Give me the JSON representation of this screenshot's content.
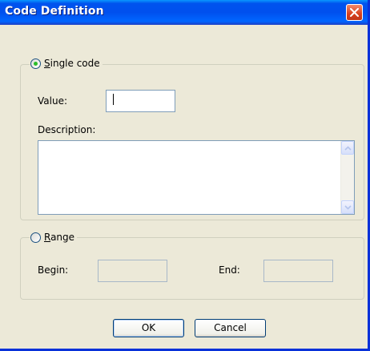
{
  "window": {
    "title": "Code Definition"
  },
  "single_code": {
    "selected": true,
    "label_prefix": "S",
    "label_rest": "ingle code",
    "value_label": "Value:",
    "value": "",
    "description_label": "Description:",
    "description": ""
  },
  "range": {
    "selected": false,
    "label_prefix": "R",
    "label_rest": "ange",
    "begin_label": "Begin:",
    "begin_value": "",
    "end_label": "End:",
    "end_value": ""
  },
  "buttons": {
    "ok": "OK",
    "cancel": "Cancel"
  },
  "icons": {
    "close": "close-icon",
    "scroll_up": "scroll-up-arrow-icon",
    "scroll_down": "scroll-down-arrow-icon"
  },
  "colors": {
    "titlebar": "#0054e3",
    "close": "#d8401d",
    "dialog_bg": "#ece9d8",
    "radio_dot": "#2bbd29"
  }
}
